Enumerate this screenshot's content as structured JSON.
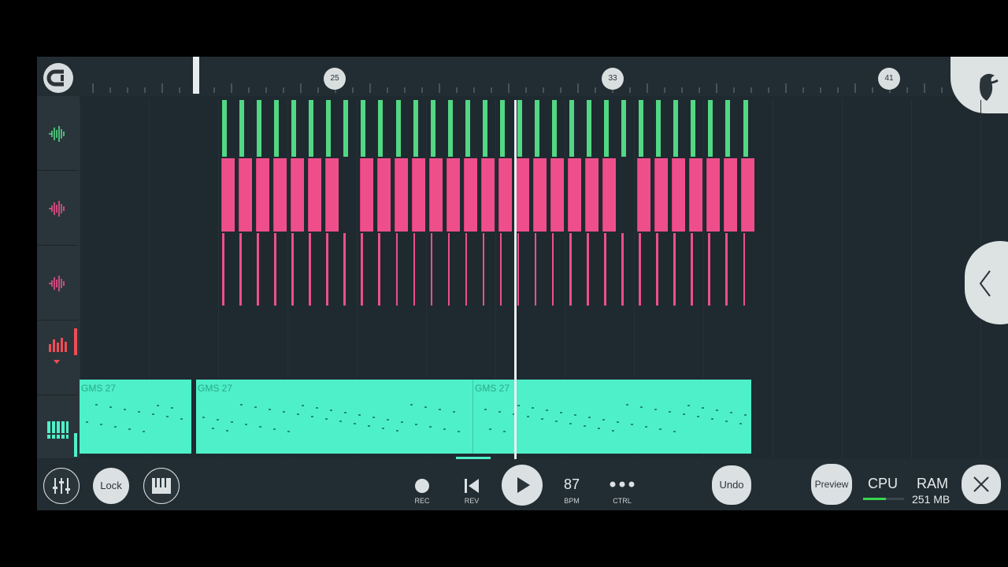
{
  "ruler": {
    "markers": [
      "25",
      "33",
      "41"
    ]
  },
  "tracks": [
    {
      "name": "audio-track-1-icon",
      "color": "#52d884"
    },
    {
      "name": "audio-track-2-icon",
      "color": "#ee4f8b"
    },
    {
      "name": "audio-track-3-icon",
      "color": "#ee4f8b"
    },
    {
      "name": "automation-track-icon",
      "color": "#ee4d56"
    },
    {
      "name": "pattern-track-icon",
      "color": "#4ef0c9"
    }
  ],
  "patterns": [
    {
      "name": "GMS 27"
    },
    {
      "name": "GMS 27"
    },
    {
      "name": "GMS 27"
    }
  ],
  "toolbar": {
    "lock_label": "Lock",
    "rec_label": "REC",
    "rev_label": "REV",
    "bpm_value": "87",
    "bpm_label": "BPM",
    "ctrl_label": "CTRL",
    "undo_label": "Undo",
    "preview_label": "Preview",
    "cpu_label": "CPU",
    "ram_label": "RAM",
    "ram_value": "251 MB"
  },
  "colors": {
    "green": "#52d884",
    "pink": "#ee4f8b",
    "teal": "#4ef0c9",
    "bg": "#1f2a30"
  }
}
